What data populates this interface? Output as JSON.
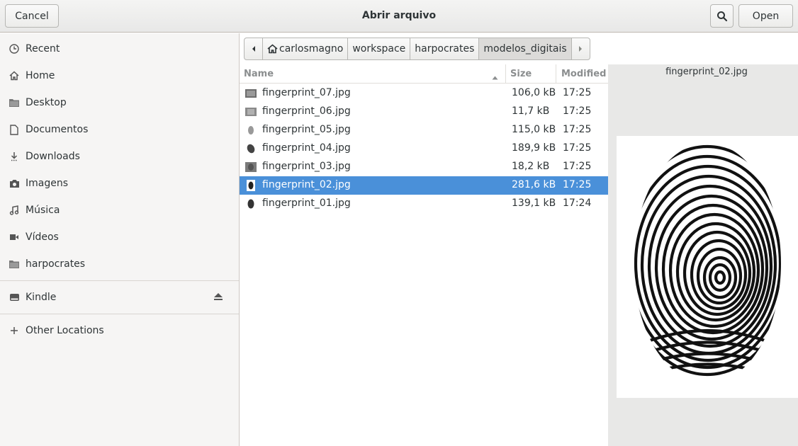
{
  "header": {
    "title": "Abrir arquivo",
    "cancel_label": "Cancel",
    "open_label": "Open"
  },
  "sidebar": {
    "items": [
      {
        "label": "Recent",
        "icon": "clock-icon"
      },
      {
        "label": "Home",
        "icon": "home-icon"
      },
      {
        "label": "Desktop",
        "icon": "folder-icon"
      },
      {
        "label": "Documentos",
        "icon": "document-icon"
      },
      {
        "label": "Downloads",
        "icon": "download-icon"
      },
      {
        "label": "Imagens",
        "icon": "camera-icon"
      },
      {
        "label": "Música",
        "icon": "music-icon"
      },
      {
        "label": "Vídeos",
        "icon": "video-icon"
      },
      {
        "label": "harpocrates",
        "icon": "folder-icon"
      }
    ],
    "devices": [
      {
        "label": "Kindle",
        "icon": "drive-icon"
      }
    ],
    "other_locations": "Other Locations"
  },
  "pathbar": {
    "crumbs": [
      "carlosmagno",
      "workspace",
      "harpocrates",
      "modelos_digitais"
    ],
    "active_index": 3
  },
  "filelist": {
    "columns": {
      "name": "Name",
      "size": "Size",
      "modified": "Modified"
    },
    "rows": [
      {
        "name": "fingerprint_07.jpg",
        "size": "106,0 kB",
        "modified": "17:25"
      },
      {
        "name": "fingerprint_06.jpg",
        "size": "11,7 kB",
        "modified": "17:25"
      },
      {
        "name": "fingerprint_05.jpg",
        "size": "115,0 kB",
        "modified": "17:25"
      },
      {
        "name": "fingerprint_04.jpg",
        "size": "189,9 kB",
        "modified": "17:25"
      },
      {
        "name": "fingerprint_03.jpg",
        "size": "18,2 kB",
        "modified": "17:25"
      },
      {
        "name": "fingerprint_02.jpg",
        "size": "281,6 kB",
        "modified": "17:25"
      },
      {
        "name": "fingerprint_01.jpg",
        "size": "139,1 kB",
        "modified": "17:24"
      }
    ],
    "selected_index": 5
  },
  "preview": {
    "filename": "fingerprint_02.jpg"
  },
  "colors": {
    "selection": "#4a90d9",
    "sidebar_bg": "#f6f5f4",
    "preview_bg": "#e8e8e7"
  }
}
